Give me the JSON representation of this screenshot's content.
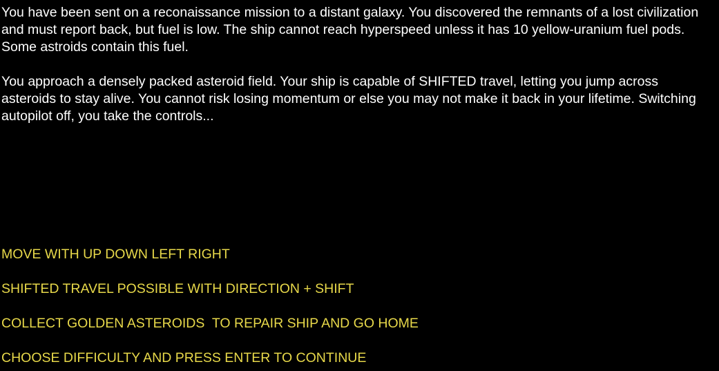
{
  "story": {
    "paragraphs": [
      "You have been sent on a reconaissance mission to a distant galaxy. You discovered the remnants of a lost civilization and must report back, but fuel is low. The ship cannot reach hyperspeed unless it has 10 yellow-uranium fuel pods. Some astroids contain this fuel.",
      "You approach a densely packed asteroid field. Your ship is capable of SHIFTED travel, letting you jump across asteroids to stay alive. You cannot risk losing momentum or else you may not make it back in your lifetime. Switching autopilot off, you take the controls..."
    ]
  },
  "instructions": {
    "lines": [
      "MOVE WITH UP DOWN LEFT RIGHT",
      "SHIFTED TRAVEL POSSIBLE WITH DIRECTION + SHIFT",
      "COLLECT GOLDEN ASTEROIDS  TO REPAIR SHIP AND GO HOME",
      "CHOOSE DIFFICULTY AND PRESS ENTER TO CONTINUE"
    ]
  },
  "colors": {
    "background": "#000000",
    "story_text": "#ffffff",
    "instruction_text": "#e8d94a"
  }
}
